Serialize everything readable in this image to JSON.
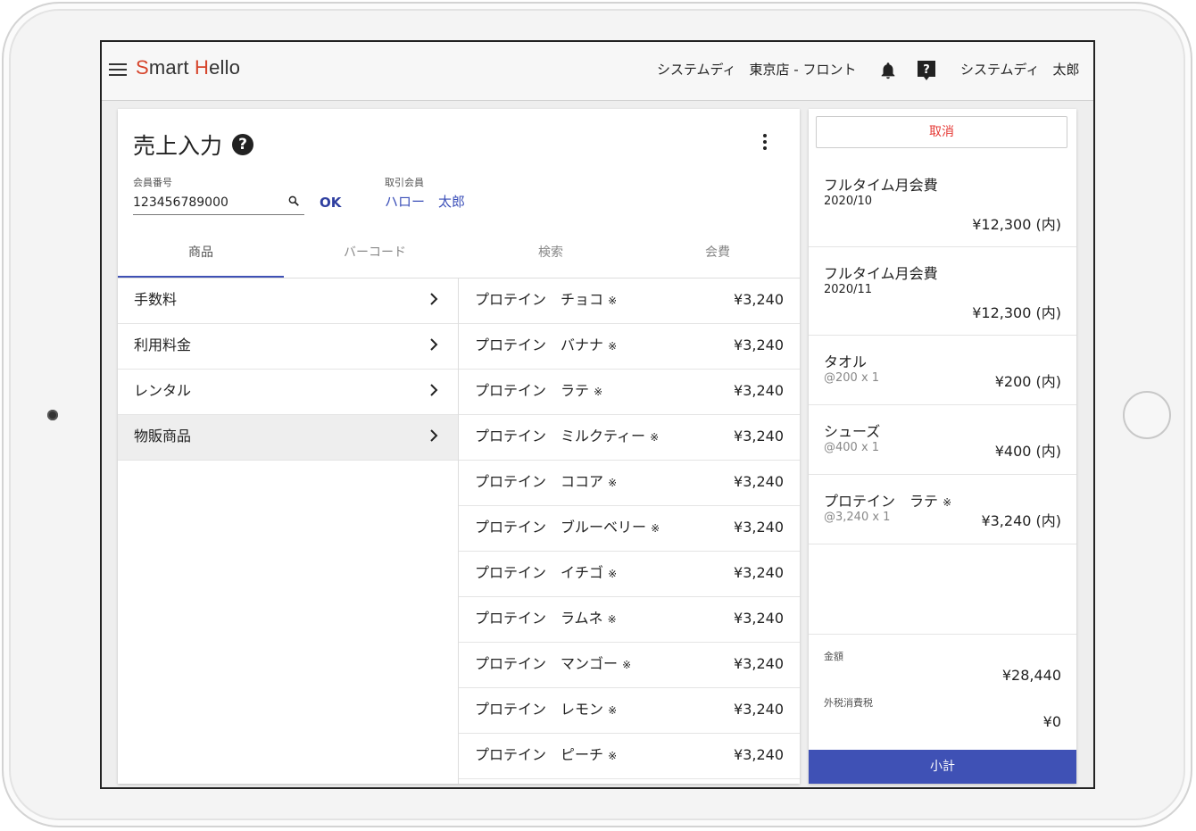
{
  "app": {
    "logo_prefix": "S",
    "logo_mid": "mart ",
    "logo_h": "H",
    "logo_rest": "ello"
  },
  "header": {
    "store": "システムディ　東京店 - フロント",
    "user": "システムディ　太郎"
  },
  "page": {
    "title": "売上入力",
    "help_icon": "?"
  },
  "member": {
    "label": "会員番号",
    "value": "123456789000",
    "ok_label": "OK",
    "partner_label": "取引会員",
    "partner_name": "ハロー　太郎"
  },
  "tabs": [
    {
      "label": "商品"
    },
    {
      "label": "バーコード"
    },
    {
      "label": "検索"
    },
    {
      "label": "会費"
    }
  ],
  "categories": [
    {
      "label": "手数料"
    },
    {
      "label": "利用料金"
    },
    {
      "label": "レンタル"
    },
    {
      "label": "物販商品"
    }
  ],
  "products": [
    {
      "name": "プロテイン　チョコ",
      "mark": "※",
      "price": "¥3,240"
    },
    {
      "name": "プロテイン　バナナ",
      "mark": "※",
      "price": "¥3,240"
    },
    {
      "name": "プロテイン　ラテ",
      "mark": "※",
      "price": "¥3,240"
    },
    {
      "name": "プロテイン　ミルクティー",
      "mark": "※",
      "price": "¥3,240"
    },
    {
      "name": "プロテイン　ココア",
      "mark": "※",
      "price": "¥3,240"
    },
    {
      "name": "プロテイン　ブルーベリー",
      "mark": "※",
      "price": "¥3,240"
    },
    {
      "name": "プロテイン　イチゴ",
      "mark": "※",
      "price": "¥3,240"
    },
    {
      "name": "プロテイン　ラムネ",
      "mark": "※",
      "price": "¥3,240"
    },
    {
      "name": "プロテイン　マンゴー",
      "mark": "※",
      "price": "¥3,240"
    },
    {
      "name": "プロテイン　レモン",
      "mark": "※",
      "price": "¥3,240"
    },
    {
      "name": "プロテイン　ピーチ",
      "mark": "※",
      "price": "¥3,240"
    }
  ],
  "cart": {
    "cancel_label": "取消",
    "items": [
      {
        "name": "フルタイム月会費",
        "sub": "2020/10",
        "amount": "¥12,300 (内)"
      },
      {
        "name": "フルタイム月会費",
        "sub": "2020/11",
        "amount": "¥12,300 (内)"
      },
      {
        "name": "タオル",
        "sub": "@200 x 1",
        "amount": "¥200 (内)"
      },
      {
        "name": "シューズ",
        "sub": "@400 x 1",
        "amount": "¥400 (内)"
      },
      {
        "name": "プロテイン　ラテ",
        "mark": "※",
        "sub": "@3,240 x 1",
        "amount": "¥3,240 (内)"
      }
    ],
    "total_label": "金額",
    "total_value": "¥28,440",
    "tax_label": "外税消費税",
    "tax_value": "¥0",
    "subtotal_label": "小計"
  },
  "colors": {
    "accent": "#3f51b5",
    "logo_red": "#d6452c",
    "cancel_red": "#e53935",
    "link_blue": "#3b4fb8"
  },
  "icons": [
    "menu-icon",
    "bell-icon",
    "help-icon",
    "search-icon",
    "more-vert-icon",
    "chevron-right-icon"
  ]
}
